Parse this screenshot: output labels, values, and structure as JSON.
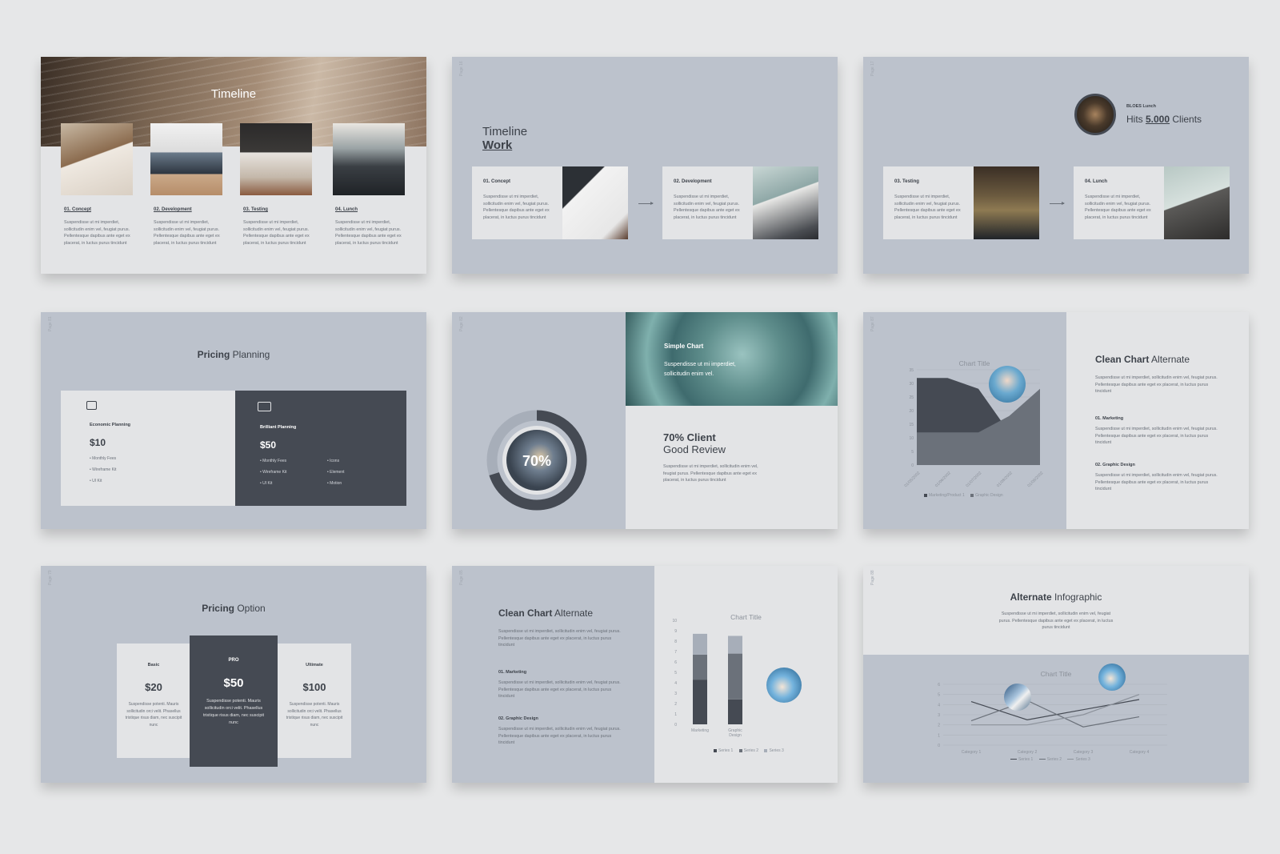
{
  "theme": {
    "slide_bg": "#bcc2cc",
    "card_bg": "#e3e4e6",
    "dark": "#454a53",
    "accent_text": "#3d424a"
  },
  "lorem_short": "Suspendisse ut mi imperdiet, sollicitudin enim vel, feugiat purus. Pellentesque dapibus ante eget ex placerat, in luctus purus tincidunt",
  "slide1": {
    "title": "Timeline",
    "items": [
      {
        "label": "01. Concept",
        "text": "Suspendisse ut mi imperdiet, sollicitudin enim vel, feugiat purus. Pellentesque dapibus ante eget ex placerat, in luctus purus tincidunt"
      },
      {
        "label": "02. Development",
        "text": "Suspendisse ut mi imperdiet, sollicitudin enim vel, feugiat purus. Pellentesque dapibus ante eget ex placerat, in luctus purus tincidunt"
      },
      {
        "label": "03. Testing",
        "text": "Suspendisse ut mi imperdiet, sollicitudin enim vel, feugiat purus. Pellentesque dapibus ante eget ex placerat, in luctus purus tincidunt"
      },
      {
        "label": "04. Lunch",
        "text": "Suspendisse ut mi imperdiet, sollicitudin enim vel, feugiat purus. Pellentesque dapibus ante eget ex placerat, in luctus purus tincidunt"
      }
    ]
  },
  "slide2": {
    "page": "Page 16",
    "title_light": "Timeline",
    "title_bold": "Work",
    "cards": [
      {
        "label": "01. Concept",
        "text": "Suspendisse ut mi imperdiet, sollicitudin enim vel, feugiat purus. Pellentesque dapibus ante eget ex placerat, in luctus purus tincidunt"
      },
      {
        "label": "02. Development",
        "text": "Suspendisse ut mi imperdiet, sollicitudin enim vel, feugiat purus. Pellentesque dapibus ante eget ex placerat, in luctus purus tincidunt"
      }
    ]
  },
  "slide3": {
    "page": "Page 17",
    "badge_small": "BLOES Lunch",
    "badge_prefix": "Hits ",
    "badge_number": "5.000",
    "badge_suffix": " Clients",
    "cards": [
      {
        "label": "03. Testing",
        "text": "Suspendisse ut mi imperdiet, sollicitudin enim vel, feugiat purus. Pellentesque dapibus ante eget ex placerat, in luctus purus tincidunt"
      },
      {
        "label": "04. Lunch",
        "text": "Suspendisse ut mi imperdiet, sollicitudin enim vel, feugiat purus. Pellentesque dapibus ante eget ex placerat, in luctus purus tincidunt"
      }
    ]
  },
  "slide4": {
    "page": "Page 81",
    "title_bold": "Pricing",
    "title_light": " Planning",
    "plans": [
      {
        "name": "Economic Planning",
        "price": "$10",
        "features": [
          "Monthly Fees",
          "Wireframe Kit",
          "UI Kit"
        ]
      },
      {
        "name": "Brilliant Planning",
        "price": "$50",
        "features": [
          "Monthly Fees",
          "Wireframe Kit",
          "UI Kit"
        ],
        "features2": [
          "Icons",
          "Element",
          "Motion"
        ]
      }
    ]
  },
  "slide5": {
    "page": "Page 82",
    "donut_label": "70%",
    "donut_value": 0.7,
    "photo_title": "Simple Chart",
    "photo_text": "Suspendisse ut mi imperdiet, sollicitudin enim vel.",
    "heading_bold": "70% Client",
    "heading_light": "Good Review",
    "text": "Suspendisse ut mi imperdiet, sollicitudin enim vel, feugiat purus. Pellentesque dapibus ante eget ex placerat, in luctus purus tincidunt"
  },
  "slide6": {
    "page": "Page 87",
    "chart_title": "Chart Title",
    "y_ticks": [
      "35",
      "30",
      "25",
      "20",
      "15",
      "10",
      "5",
      "0"
    ],
    "x_ticks": [
      "01/05/2002",
      "01/06/2002",
      "01/07/2002",
      "01/08/2002",
      "01/09/2002"
    ],
    "legend": [
      "Marketing/Product 1",
      "Graphic Design"
    ],
    "title_bold": "Clean Chart",
    "title_light": " Alternate",
    "intro": "Suspendisse ut mi imperdiet, sollicitudin enim vel, feugiat purus. Pellentesque dapibus ante eget ex placerat, in luctus purus tincidunt",
    "sections": [
      {
        "label": "01. Marketing",
        "text": "Suspendisse ut mi imperdiet, sollicitudin enim vel, feugiat purus. Pellentesque dapibus ante eget ex placerat, in luctus purus tincidunt"
      },
      {
        "label": "02. Graphic Design",
        "text": "Suspendisse ut mi imperdiet, sollicitudin enim vel, feugiat purus. Pellentesque dapibus ante eget ex placerat, in luctus purus tincidunt"
      }
    ]
  },
  "slide7": {
    "page": "Page 79",
    "title_bold": "Pricing",
    "title_light": " Option",
    "plans": [
      {
        "name": "Basic",
        "price": "$20",
        "text": "Suspendisse potenti. Mauris sollicitudin orci velit. Phasellus tristique risus diam, nec suscipit nunc"
      },
      {
        "name": "PRO",
        "price": "$50",
        "text": "Suspendisse potenti. Mauris sollicitudin orci velit. Phasellus tristique risus diam, nec suscipit nunc"
      },
      {
        "name": "Ultimate",
        "price": "$100",
        "text": "Suspendisse potenti. Mauris sollicitudin orci velit. Phasellus tristique risus diam, nec suscipit nunc"
      }
    ]
  },
  "slide8": {
    "page": "Page 85",
    "title_bold": "Clean Chart",
    "title_light": " Alternate",
    "intro": "Suspendisse ut mi imperdiet, sollicitudin enim vel, feugiat purus. Pellentesque dapibus ante eget ex placerat, in luctus purus tincidunt",
    "sections": [
      {
        "label": "01. Marketing",
        "text": "Suspendisse ut mi imperdiet, sollicitudin enim vel, feugiat purus. Pellentesque dapibus ante eget ex placerat, in luctus purus tincidunt"
      },
      {
        "label": "02. Graphic Design",
        "text": "Suspendisse ut mi imperdiet, sollicitudin enim vel, feugiat purus. Pellentesque dapibus ante eget ex placerat, in luctus purus tincidunt"
      }
    ],
    "chart_title": "Chart Title",
    "y_ticks": [
      "10",
      "9",
      "8",
      "7",
      "6",
      "5",
      "4",
      "3",
      "2",
      "1",
      "0"
    ],
    "categories": [
      "Marketing",
      "Graphic Design"
    ],
    "legend": [
      "Series 1",
      "Series 2",
      "Series 3"
    ]
  },
  "slide9": {
    "page": "Page 88",
    "title_bold": "Alternate",
    "title_light": " Infographic",
    "text": "Suspendisse ut mi imperdiet, sollicitudin enim vel, feugiat purus. Pellentesque dapibus ante eget ex placerat, in luctus purus tincidunt",
    "chart_title": "Chart Title",
    "y_ticks": [
      "6",
      "5",
      "4",
      "3",
      "2",
      "1",
      "0"
    ],
    "x_ticks": [
      "Category 1",
      "Category 2",
      "Category 3",
      "Category 4"
    ],
    "legend": [
      "Series 1",
      "Series 2",
      "Series 3"
    ]
  },
  "chart_data": [
    {
      "type": "area",
      "title": "Chart Title",
      "x": [
        "01/05/2002",
        "01/06/2002",
        "01/07/2002",
        "01/08/2002",
        "01/09/2002"
      ],
      "ylim": [
        0,
        35
      ],
      "series": [
        {
          "name": "Marketing/Product 1",
          "values": [
            32,
            32,
            28,
            12,
            28
          ]
        },
        {
          "name": "Graphic Design",
          "values": [
            12,
            12,
            12,
            18,
            28
          ]
        }
      ]
    },
    {
      "type": "bar",
      "stacked": true,
      "title": "Chart Title",
      "categories": [
        "Marketing",
        "Graphic Design"
      ],
      "ylim": [
        0,
        10
      ],
      "series": [
        {
          "name": "Series 1",
          "values": [
            4.3,
            2.4
          ]
        },
        {
          "name": "Series 2",
          "values": [
            2.4,
            4.4
          ]
        },
        {
          "name": "Series 3",
          "values": [
            2.0,
            1.7
          ]
        }
      ]
    },
    {
      "type": "line",
      "title": "Chart Title",
      "categories": [
        "Category 1",
        "Category 2",
        "Category 3",
        "Category 4"
      ],
      "ylim": [
        0,
        6
      ],
      "series": [
        {
          "name": "Series 1",
          "values": [
            4.3,
            2.5,
            3.5,
            4.5
          ]
        },
        {
          "name": "Series 2",
          "values": [
            2.4,
            4.4,
            1.8,
            2.8
          ]
        },
        {
          "name": "Series 3",
          "values": [
            2.0,
            2.0,
            3.0,
            5.0
          ]
        }
      ]
    }
  ]
}
